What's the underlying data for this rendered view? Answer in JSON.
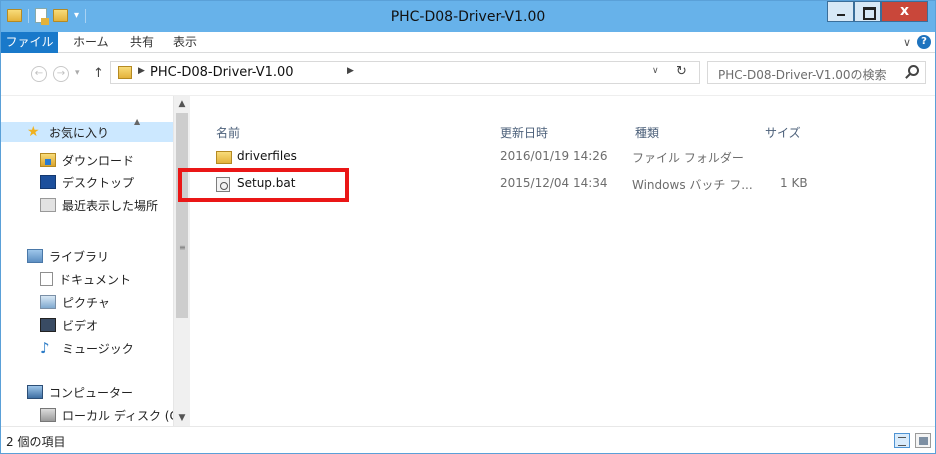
{
  "window": {
    "title": "PHC-D08-Driver-V1.00",
    "close_label": "x"
  },
  "ribbon": {
    "tabs": [
      "ファイル",
      "ホーム",
      "共有",
      "表示"
    ]
  },
  "navigation": {
    "address": "PHC-D08-Driver-V1.00",
    "search_placeholder": "PHC-D08-Driver-V1.00の検索"
  },
  "sidebar": {
    "items": [
      {
        "label": "お気に入り",
        "icon": "star-icon"
      },
      {
        "label": "ダウンロード",
        "icon": "downloads-folder-icon"
      },
      {
        "label": "デスクトップ",
        "icon": "desktop-icon"
      },
      {
        "label": "最近表示した場所",
        "icon": "recent-places-icon"
      },
      {
        "label": "ライブラリ",
        "icon": "library-icon"
      },
      {
        "label": "ドキュメント",
        "icon": "documents-icon"
      },
      {
        "label": "ピクチャ",
        "icon": "pictures-icon"
      },
      {
        "label": "ビデオ",
        "icon": "videos-icon"
      },
      {
        "label": "ミュージック",
        "icon": "music-icon"
      },
      {
        "label": "コンピューター",
        "icon": "computer-icon"
      },
      {
        "label": "ローカル ディスク (C",
        "icon": "local-disk-icon"
      }
    ]
  },
  "columns": {
    "name": "名前",
    "modified": "更新日時",
    "type": "種類",
    "size": "サイズ"
  },
  "files": [
    {
      "name": "driverfiles",
      "modified": "2016/01/19 14:26",
      "type": "ファイル フォルダー",
      "size": "",
      "icon": "folder-icon"
    },
    {
      "name": "Setup.bat",
      "modified": "2015/12/04 14:34",
      "type": "Windows バッチ フ...",
      "size": "1 KB",
      "icon": "batch-file-icon"
    }
  ],
  "status": {
    "item_count": "2 個の項目"
  },
  "colors": {
    "titlebar": "#67b2ea",
    "file_tab": "#1979ca",
    "highlight": "#ea1616",
    "selected": "#cce8ff"
  }
}
